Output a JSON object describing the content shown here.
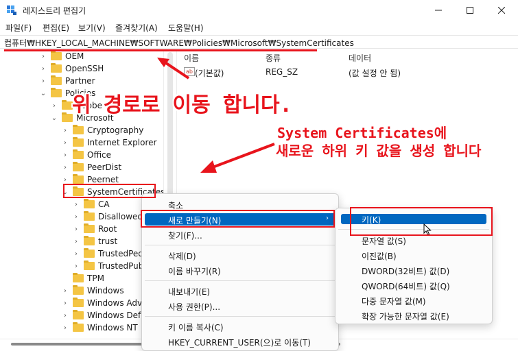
{
  "window": {
    "title": "레지스트리 편집기"
  },
  "menu": [
    "파일(F)",
    "편집(E)",
    "보기(V)",
    "즐겨찾기(A)",
    "도움말(H)"
  ],
  "address": "컴퓨터₩HKEY_LOCAL_MACHINE₩SOFTWARE₩Policies₩Microsoft₩SystemCertificates",
  "tree": [
    {
      "label": "OEM",
      "chev": "›"
    },
    {
      "label": "OpenSSH",
      "chev": "›"
    },
    {
      "label": "Partner",
      "chev": "›"
    },
    {
      "label": "Policies",
      "chev": "⌄"
    },
    {
      "label": "Adobe",
      "chev": "›"
    },
    {
      "label": "Microsoft",
      "chev": "⌄"
    },
    {
      "label": "Cryptography",
      "chev": "›"
    },
    {
      "label": "Internet Explorer",
      "chev": "›"
    },
    {
      "label": "Office",
      "chev": "›"
    },
    {
      "label": "PeerDist",
      "chev": "›"
    },
    {
      "label": "Peernet",
      "chev": "›"
    },
    {
      "label": "SystemCertificates",
      "chev": "⌄"
    },
    {
      "label": "CA",
      "chev": "›"
    },
    {
      "label": "Disallowed",
      "chev": "›"
    },
    {
      "label": "Root",
      "chev": "›"
    },
    {
      "label": "trust",
      "chev": "›"
    },
    {
      "label": "TrustedPeople",
      "chev": "›"
    },
    {
      "label": "TrustedPublisher",
      "chev": "›"
    },
    {
      "label": "TPM",
      "chev": ""
    },
    {
      "label": "Windows",
      "chev": "›"
    },
    {
      "label": "Windows Advanced",
      "chev": "›"
    },
    {
      "label": "Windows Defender",
      "chev": "›"
    },
    {
      "label": "Windows NT",
      "chev": "›"
    }
  ],
  "list": {
    "headers": [
      "이름",
      "종류",
      "데이터"
    ],
    "rows": [
      {
        "name": "(기본값)",
        "type": "REG_SZ",
        "data": "(값 설정 안 됨)"
      }
    ]
  },
  "context_menu": {
    "items": [
      "축소",
      "새로 만들기(N)",
      "찾기(F)...",
      "삭제(D)",
      "이름 바꾸기(R)",
      "내보내기(E)",
      "사용 권한(P)...",
      "키 이름 복사(C)",
      "HKEY_CURRENT_USER(으)로 이동(T)"
    ],
    "arrow": "›"
  },
  "submenu": {
    "items": [
      "키(K)",
      "문자열 값(S)",
      "이진값(B)",
      "DWORD(32비트) 값(D)",
      "QWORD(64비트) 값(Q)",
      "다중 문자열 값(M)",
      "확장 가능한 문자열 값(E)"
    ]
  },
  "annotations": {
    "move_path": "위 경로로 이동 합니다.",
    "line1": "System Certificates에",
    "line2": "새로운 하위 키 값을 생성 합니다"
  },
  "colors": {
    "accent": "#0067c0",
    "annotation": "#e8141c",
    "folder": "#f4c544"
  }
}
